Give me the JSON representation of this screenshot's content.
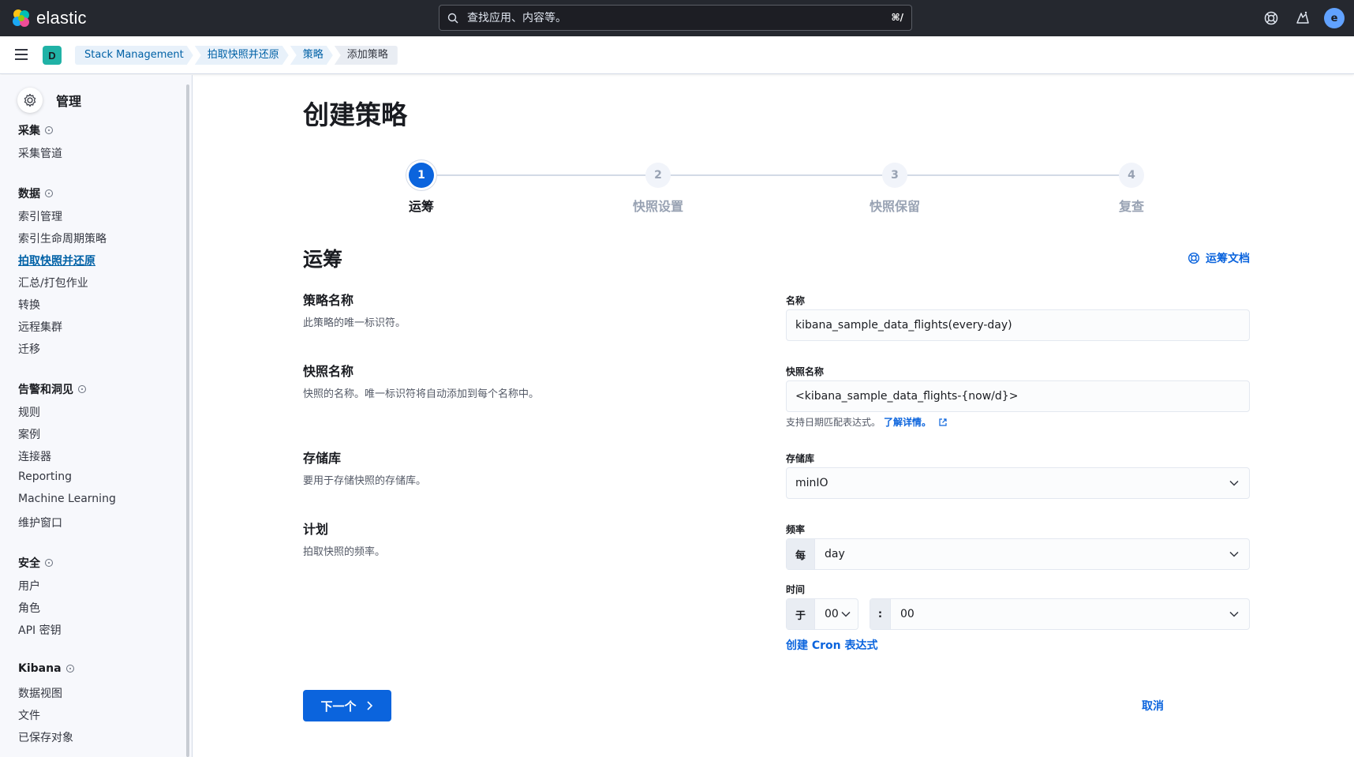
{
  "header": {
    "logo_text": "elastic",
    "search_placeholder": "查找应用、内容等。",
    "search_shortcut": "⌘/",
    "avatar_initial": "e"
  },
  "breadcrumb": {
    "space_initial": "D",
    "items": [
      "Stack Management",
      "拍取快照并还原",
      "策略",
      "添加策略"
    ]
  },
  "sidebar": {
    "title": "管理",
    "groups": [
      {
        "label": "采集",
        "items": [
          "采集管道"
        ]
      },
      {
        "label": "数据",
        "items": [
          "索引管理",
          "索引生命周期策略",
          "拍取快照并还原",
          "汇总/打包作业",
          "转换",
          "远程集群",
          "迁移"
        ]
      },
      {
        "label": "告警和洞见",
        "items": [
          "规则",
          "案例",
          "连接器",
          "Reporting",
          "Machine Learning",
          "维护窗口"
        ]
      },
      {
        "label": "安全",
        "items": [
          "用户",
          "角色",
          "API 密钥"
        ]
      },
      {
        "label": "Kibana",
        "items": [
          "数据视图",
          "文件",
          "已保存对象"
        ]
      }
    ],
    "active_item": "拍取快照并还原"
  },
  "page": {
    "title": "创建策略",
    "steps": [
      {
        "number": "1",
        "label": "运筹"
      },
      {
        "number": "2",
        "label": "快照设置"
      },
      {
        "number": "3",
        "label": "快照保留"
      },
      {
        "number": "4",
        "label": "复查"
      }
    ],
    "current_step": 1,
    "section_title": "运筹",
    "doc_link": "运筹文档"
  },
  "form": {
    "name_title": "策略名称",
    "name_desc": "此策略的唯一标识符。",
    "name_label": "名称",
    "name_value": "kibana_sample_data_flights(every-day)",
    "snapshot_title": "快照名称",
    "snapshot_desc": "快照的名称。唯一标识符将自动添加到每个名称中。",
    "snapshot_label": "快照名称",
    "snapshot_value": "<kibana_sample_data_flights-{now/d}>",
    "snapshot_help": "支持日期匹配表达式。",
    "snapshot_help_link": "了解详情。",
    "repo_title": "存储库",
    "repo_desc": "要用于存储快照的存储库。",
    "repo_label": "存储库",
    "repo_value": "minIO",
    "schedule_title": "计划",
    "schedule_desc": "拍取快照的频率。",
    "freq_label": "频率",
    "freq_prepend": "每",
    "freq_value": "day",
    "time_label": "时间",
    "time_prepend": "于",
    "hour_value": "00",
    "time_sep": ":",
    "minute_value": "00",
    "cron_link": "创建 Cron 表达式"
  },
  "actions": {
    "next_label": "下一个",
    "cancel_label": "取消"
  },
  "colors": {
    "primary": "#0b64dd",
    "header_bg": "#25282f",
    "space_badge": "#20b2a6"
  }
}
